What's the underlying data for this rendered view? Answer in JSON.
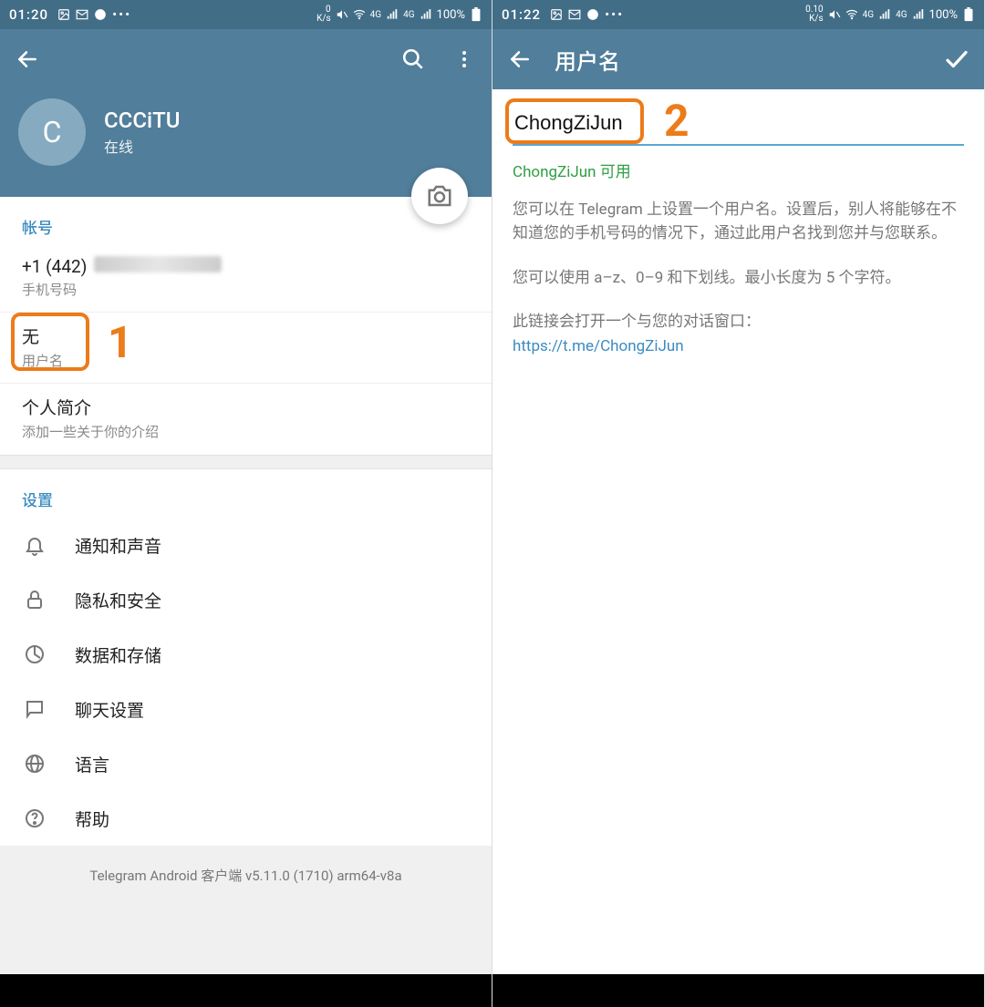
{
  "statusbar": {
    "time1": "01:20",
    "time2": "01:22",
    "ks1_top": "0",
    "ks1_bottom": "K/s",
    "ks2_top": "0.10",
    "ks2_bottom": "K/s",
    "net_label": "4G",
    "battery_pct": "100%"
  },
  "screen1": {
    "avatar_letter": "C",
    "profile_name": "CCCiTU",
    "profile_status": "在线",
    "account_header": "帐号",
    "phone_prefix": "+1 (442)",
    "phone_label": "手机号码",
    "username_value": "无",
    "username_label": "用户名",
    "bio_title": "个人简介",
    "bio_hint": "添加一些关于你的介绍",
    "settings_header": "设置",
    "settings": [
      {
        "label": "通知和声音",
        "icon": "bell-icon"
      },
      {
        "label": "隐私和安全",
        "icon": "lock-icon"
      },
      {
        "label": "数据和存储",
        "icon": "data-icon"
      },
      {
        "label": "聊天设置",
        "icon": "chat-icon"
      },
      {
        "label": "语言",
        "icon": "globe-icon"
      },
      {
        "label": "帮助",
        "icon": "help-icon"
      }
    ],
    "footer": "Telegram Android 客户端 v5.11.0 (1710) arm64-v8a"
  },
  "screen2": {
    "title": "用户名",
    "input_value": "ChongZiJun",
    "available_text": "ChongZiJun 可用",
    "help1": "您可以在 Telegram 上设置一个用户名。设置后，别人将能够在不知道您的手机号码的情况下，通过此用户名找到您并与您联系。",
    "help2": "您可以使用 a–z、0–9 和下划线。最小长度为 5 个字符。",
    "help3": "此链接会打开一个与您的对话窗口：",
    "link": "https://t.me/ChongZiJun"
  },
  "annotations": {
    "num1": "1",
    "num2": "2"
  }
}
